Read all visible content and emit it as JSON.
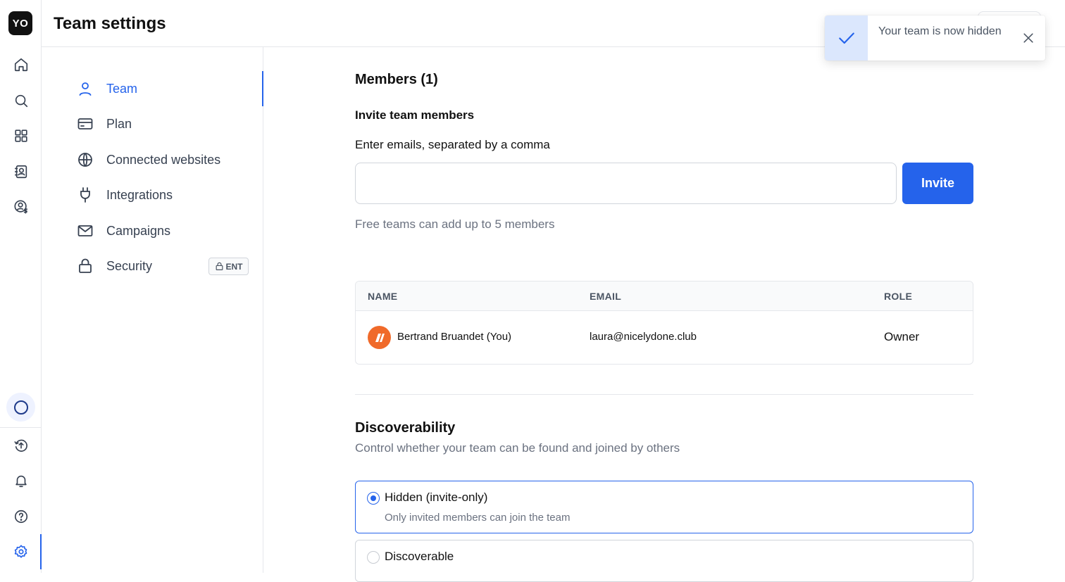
{
  "app": {
    "logo_text": "YO"
  },
  "header": {
    "title": "Team settings"
  },
  "toast": {
    "message": "Your team is now hidden",
    "icon": "check-icon",
    "close_icon": "close-icon"
  },
  "rail": {
    "items": [
      {
        "icon": "home-icon"
      },
      {
        "icon": "search-icon"
      },
      {
        "icon": "grid-icon"
      },
      {
        "icon": "contacts-icon"
      },
      {
        "icon": "user-billing-icon"
      }
    ],
    "bottom": [
      {
        "icon": "status-circle-icon"
      },
      {
        "icon": "upload-icon"
      },
      {
        "icon": "bell-icon"
      },
      {
        "icon": "help-icon"
      },
      {
        "icon": "gear-icon",
        "active": true
      }
    ]
  },
  "subnav": {
    "items": [
      {
        "label": "Team",
        "icon": "user-icon",
        "active": true
      },
      {
        "label": "Plan",
        "icon": "credit-card-icon"
      },
      {
        "label": "Connected websites",
        "icon": "globe-icon"
      },
      {
        "label": "Integrations",
        "icon": "plug-icon"
      },
      {
        "label": "Campaigns",
        "icon": "mail-icon"
      },
      {
        "label": "Security",
        "icon": "lock-icon",
        "badge": "ENT"
      }
    ]
  },
  "members": {
    "heading": "Members (1)",
    "invite_heading": "Invite team members",
    "emails_label": "Enter emails, separated by a comma",
    "emails_value": "",
    "emails_placeholder": "",
    "invite_button": "Invite",
    "hint": "Free teams can add up to 5 members",
    "table": {
      "columns": [
        "NAME",
        "EMAIL",
        "ROLE"
      ],
      "rows": [
        {
          "name": "Bertrand Bruandet (You)",
          "email": "laura@nicelydone.club",
          "role": "Owner"
        }
      ]
    }
  },
  "discoverability": {
    "heading": "Discoverability",
    "subheading": "Control whether your team can be found and joined by others",
    "options": [
      {
        "title": "Hidden (invite-only)",
        "description": "Only invited members can join the team",
        "selected": true
      },
      {
        "title": "Discoverable",
        "selected": false
      }
    ]
  },
  "colors": {
    "accent": "#2563eb",
    "toast_bg": "#dbe7fd",
    "avatar": "#f06a2a"
  }
}
